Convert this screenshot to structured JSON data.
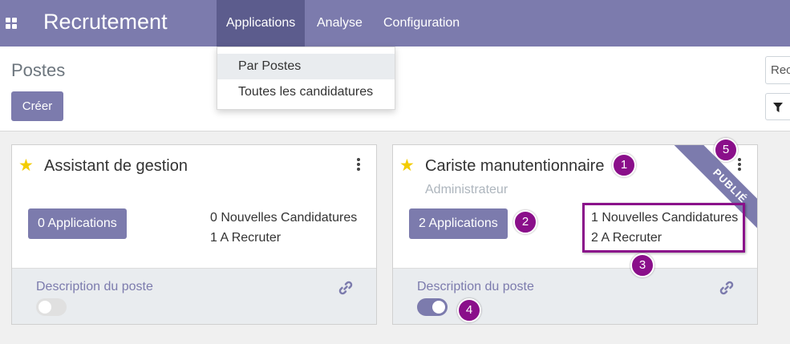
{
  "navbar": {
    "app_name": "Recrutement",
    "menu": [
      "Applications",
      "Analyse",
      "Configuration"
    ]
  },
  "dropdown": {
    "items": [
      "Par Postes",
      "Toutes les candidatures"
    ]
  },
  "control_panel": {
    "title": "Postes",
    "create_label": "Créer",
    "search_text": "Rec"
  },
  "cards": [
    {
      "title": "Assistant de gestion",
      "subtitle": "",
      "applications_label": "0 Applications",
      "new_applications": "0 Nouvelles Candidatures",
      "to_recruit": "1 A Recruter",
      "description_label": "Description du poste",
      "published": false,
      "description_toggle": "off"
    },
    {
      "title": "Cariste manutentionnaire",
      "subtitle": "Administrateur",
      "applications_label": "2 Applications",
      "new_applications": "1 Nouvelles Candidatures",
      "to_recruit": "2 A Recruter",
      "description_label": "Description du poste",
      "published": true,
      "ribbon_label": "PUBLIÉ",
      "description_toggle": "on"
    }
  ],
  "annotations": [
    "1",
    "2",
    "3",
    "4",
    "5"
  ],
  "colors": {
    "primary": "#7c7bad",
    "navbar": "#7c7bad",
    "nav_active": "#5c5c8d",
    "star": "#f3cc00",
    "annotation": "#8a0f8a"
  },
  "icons": [
    "apps-grid-icon",
    "star-icon",
    "kebab-menu-icon",
    "link-icon",
    "filter-icon"
  ]
}
